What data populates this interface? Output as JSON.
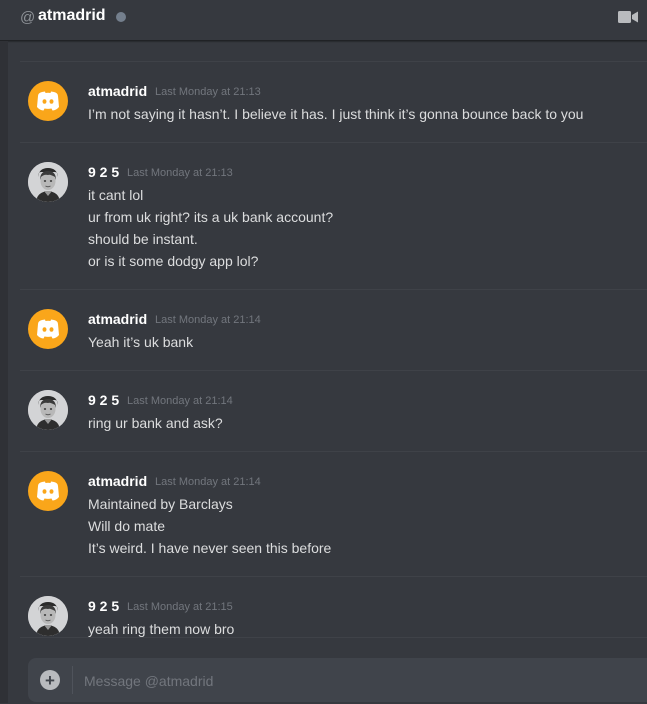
{
  "header": {
    "at_symbol": "@",
    "name": "atmadrid",
    "status": "offline",
    "status_color": "#747f8d",
    "video_icon": "video-camera-icon"
  },
  "colors": {
    "background": "#36393f",
    "discord_avatar": "#faa61a",
    "username": "#ffffff",
    "timestamp": "#72767d",
    "message_text": "#dcddde"
  },
  "messages": [
    {
      "author": "atmadrid",
      "avatar": "discord-logo-icon",
      "timestamp": "Last Monday at 21:13",
      "lines": [
        "I’m not saying it hasn’t. I believe it has. I just think it’s gonna bounce back to you"
      ]
    },
    {
      "author": "9 2 5",
      "avatar": "user-photo-avatar",
      "timestamp": "Last Monday at 21:13",
      "lines": [
        "it cant lol",
        "ur from uk right? its a uk bank account?",
        "should be instant.",
        "or is it some dodgy app lol?"
      ]
    },
    {
      "author": "atmadrid",
      "avatar": "discord-logo-icon",
      "timestamp": "Last Monday at 21:14",
      "lines": [
        "Yeah it’s uk bank"
      ]
    },
    {
      "author": "9 2 5",
      "avatar": "user-photo-avatar",
      "timestamp": "Last Monday at 21:14",
      "lines": [
        "ring ur bank and ask?"
      ]
    },
    {
      "author": "atmadrid",
      "avatar": "discord-logo-icon",
      "timestamp": "Last Monday at 21:14",
      "lines": [
        "Maintained by Barclays",
        "Will do mate",
        "It’s weird. I have never seen this before"
      ]
    },
    {
      "author": "9 2 5",
      "avatar": "user-photo-avatar",
      "timestamp": "Last Monday at 21:15",
      "lines": [
        "yeah ring them now bro"
      ]
    }
  ],
  "composer": {
    "placeholder": "Message @atmadrid",
    "attach_icon": "plus-circle-icon"
  }
}
